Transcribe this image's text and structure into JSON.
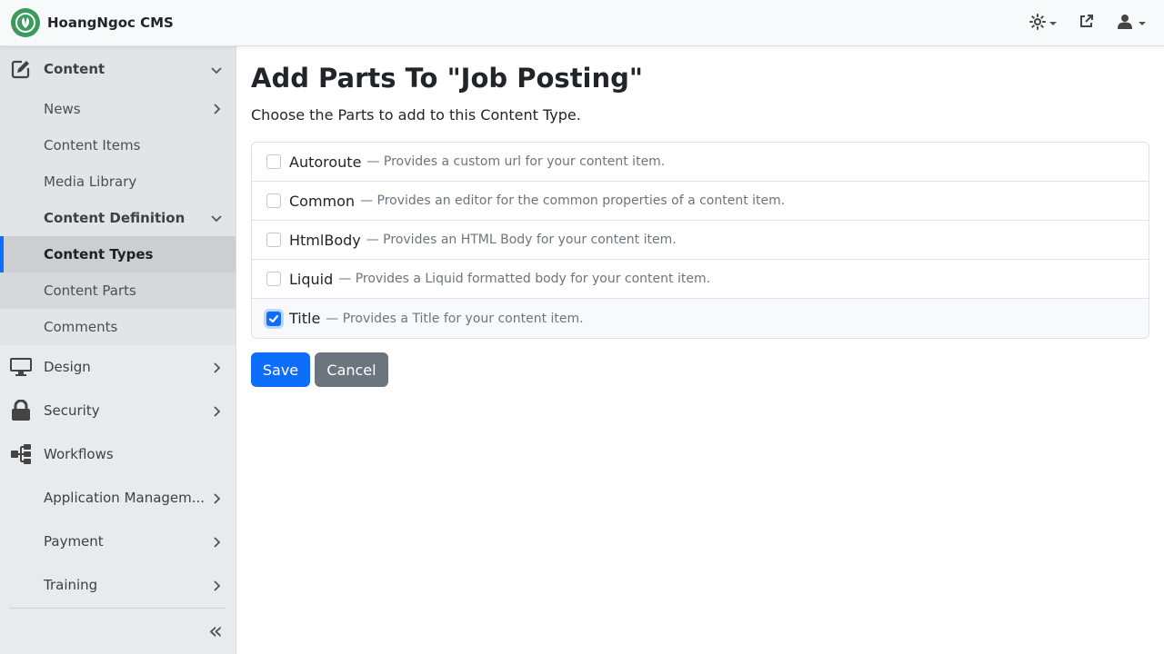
{
  "app": {
    "title": "HoangNgoc CMS"
  },
  "topbar": {
    "theme_icon": "sun-icon",
    "external_icon": "external-link-icon",
    "user_icon": "user-icon"
  },
  "sidebar": {
    "content": {
      "label": "Content",
      "icon": "edit-icon"
    },
    "content_children": [
      {
        "label": "News"
      },
      {
        "label": "Content Items"
      },
      {
        "label": "Media Library"
      },
      {
        "label": "Content Definition"
      },
      {
        "label": "Content Types"
      },
      {
        "label": "Content Parts"
      },
      {
        "label": "Comments"
      }
    ],
    "design": {
      "label": "Design",
      "icon": "monitor-icon"
    },
    "security": {
      "label": "Security",
      "icon": "lock-icon"
    },
    "workflows": {
      "label": "Workflows",
      "icon": "workflow-icon"
    },
    "application_management": {
      "label": "Application Managem..."
    },
    "payment": {
      "label": "Payment"
    },
    "training": {
      "label": "Training"
    }
  },
  "main": {
    "title": "Add Parts To \"Job Posting\"",
    "subtitle": "Choose the Parts to add to this Content Type.",
    "parts": [
      {
        "name": "Autoroute",
        "desc": "— Provides a custom url for your content item.",
        "checked": false
      },
      {
        "name": "Common",
        "desc": "— Provides an editor for the common properties of a content item.",
        "checked": false
      },
      {
        "name": "HtmlBody",
        "desc": "— Provides an HTML Body for your content item.",
        "checked": false
      },
      {
        "name": "Liquid",
        "desc": "— Provides a Liquid formatted body for your content item.",
        "checked": false
      },
      {
        "name": "Title",
        "desc": "— Provides a Title for your content item.",
        "checked": true
      }
    ],
    "save_label": "Save",
    "cancel_label": "Cancel"
  },
  "colors": {
    "primary": "#0d6efd",
    "secondary": "#6c757d",
    "brand": "#3a9b5c"
  },
  "collapse_glyph": "«"
}
